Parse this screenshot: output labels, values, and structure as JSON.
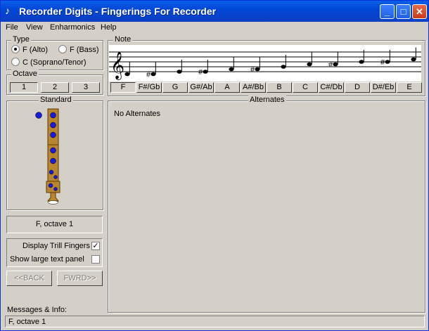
{
  "window": {
    "title": "Recorder Digits - Fingerings For Recorder",
    "controls": {
      "minimize": "_",
      "maximize": "□",
      "close": "✕"
    }
  },
  "menu": [
    "File",
    "View",
    "Enharmonics",
    "Help"
  ],
  "type_group": {
    "label": "Type",
    "options": [
      {
        "label": "F (Alto)",
        "selected": true
      },
      {
        "label": "F (Bass)",
        "selected": false
      },
      {
        "label": "C (Soprano/Tenor)",
        "selected": false
      }
    ]
  },
  "octave_group": {
    "label": "Octave",
    "buttons": [
      "1",
      "2",
      "3"
    ],
    "selected": "1"
  },
  "note_group": {
    "label": "Note",
    "buttons": [
      "F",
      "F#/Gb",
      "G",
      "G#/Ab",
      "A",
      "A#/Bb",
      "B",
      "C",
      "C#/Db",
      "D",
      "D#/Eb",
      "E"
    ],
    "selected": "F"
  },
  "standard_group": {
    "label": "Standard"
  },
  "alternates_group": {
    "label": "Alternates",
    "message": "No Alternates"
  },
  "current_note": "F, octave 1",
  "options": {
    "display_trill_fingers": {
      "label": "Display Trill Fingers",
      "checked": true
    },
    "show_large_text_panel": {
      "label": "Show large text panel",
      "checked": false
    }
  },
  "nav": {
    "back": "<<BACK",
    "forward": "FWRD>>"
  },
  "messages": {
    "label": "Messages & Info:",
    "text": "F, octave 1"
  },
  "colors": {
    "title_bar": "#0a5fe8",
    "hole": "#1a1adc",
    "recorder_wood": "#b8862e"
  }
}
